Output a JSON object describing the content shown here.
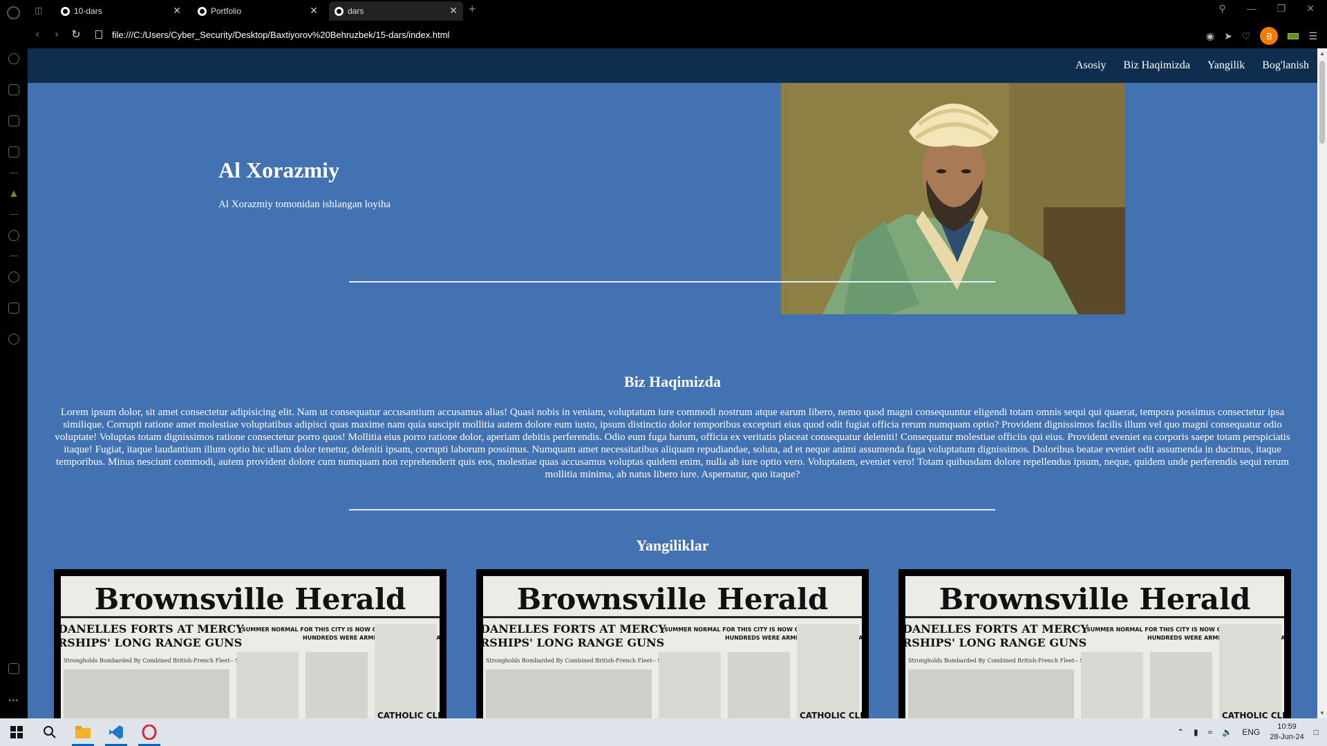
{
  "browser": {
    "tabs": [
      {
        "label": "10-dars"
      },
      {
        "label": "Portfolio"
      },
      {
        "label": "dars"
      }
    ],
    "url": "file:///C:/Users/Cyber_Security/Desktop/Baxtiyorov%20Behruzbek/15-dars/index.html",
    "profile_initial": "B"
  },
  "site": {
    "nav": [
      {
        "label": "Asosiy"
      },
      {
        "label": "Biz Haqimizda"
      },
      {
        "label": "Yangilik"
      },
      {
        "label": "Bog'lanish"
      }
    ],
    "hero": {
      "title": "Al Xorazmiy",
      "subtitle": "Al Xorazmiy tomonidan ishlangan loyiha"
    },
    "about": {
      "title": "Biz Haqimizda",
      "text": "Lorem ipsum dolor, sit amet consectetur adipisicing elit. Nam ut consequatur accusantium accusamus alias! Quasi nobis in veniam, voluptatum iure commodi nostrum atque earum libero, nemo quod magni consequuntur eligendi totam omnis sequi qui quaerat, tempora possimus consectetur ipsa similique. Corrupti ratione amet molestiae voluptatibus adipisci quas maxime nam quia suscipit mollitia autem dolore eum iusto, ipsum distinctio dolor temporibus excepturi eius quod odit fugiat officia rerum numquam optio? Provident dignissimos facilis illum vel quo magni consequatur odio voluptate! Voluptas totam dignissimos ratione consectetur porro quos! Mollitia eius porro ratione dolor, aperiam debitis perferendis. Odio eum fuga harum, officia ex veritatis placeat consequatur deleniti! Consequatur molestiae officiis qui eius. Provident eveniet ea corporis saepe totam perspiciatis itaque! Fugiat, itaque laudantium illum optio hic ullam dolor tenetur, deleniti ipsam, corrupti laborum possimus. Numquam amet necessitatibus aliquam repudiandae, soluta, ad et neque animi assumenda fuga voluptatum dignissimos. Doloribus beatae eveniet odit assumenda in ducimus, itaque temporibus. Minus nesciunt commodi, autem provident dolore cum numquam non reprehenderit quis eos, molestiae quas accusamus voluptas quidem enim, nulla ab iure optio vero. Voluptatem, eveniet vero! Totam quibusdam dolore repellendus ipsum, neque, quidem unde perferendis sequi rerum mollitia minima, ab natus libero iure. Aspernatur, quo itaque?"
    },
    "news": {
      "title": "Yangiliklar",
      "cards": [
        {
          "masthead": "Brownsville Herald",
          "headline": "DANELLES FORTS AT MERCY",
          "subhead": "RSHIPS' LONG RANGE GUNS",
          "col2": "SUMMER NORMAL FOR THIS CITY IS NOW CERTAIN",
          "col3": "HUNDREDS WERE ARMED; NOTHING HAS HAPPENED",
          "blurb": "Strongholds Bombarded By Combined British-French Fleet-- Seaplanes, Cooperate.",
          "corner": "CATHOLIC CLERGY"
        },
        {
          "masthead": "Brownsville Herald",
          "headline": "DANELLES FORTS AT MERCY",
          "subhead": "RSHIPS' LONG RANGE GUNS",
          "col2": "SUMMER NORMAL FOR THIS CITY IS NOW CERTAIN",
          "col3": "HUNDREDS WERE ARMED; NOTHING HAS HAPPENED",
          "blurb": "Strongholds Bombarded By Combined British-French Fleet-- Seaplanes, Cooperate.",
          "corner": "CATHOLIC CLERGY"
        },
        {
          "masthead": "Brownsville Herald",
          "headline": "DANELLES FORTS AT MERCY",
          "subhead": "RSHIPS' LONG RANGE GUNS",
          "col2": "SUMMER NORMAL FOR THIS CITY IS NOW CERTAIN",
          "col3": "HUNDREDS WERE ARMED; NOTHING HAS HAPPENED",
          "blurb": "Strongholds Bombarded By Combined British-French Fleet-- Seaplanes, Cooperate.",
          "corner": "CATHOLIC CLERGY"
        }
      ]
    }
  },
  "taskbar": {
    "language": "ENG",
    "time": "10:59",
    "date": "28-Jun-24"
  },
  "colors": {
    "page_bg": "#4272b2",
    "nav_bg": "#0f2d4f",
    "avatar": "#f57c00"
  }
}
